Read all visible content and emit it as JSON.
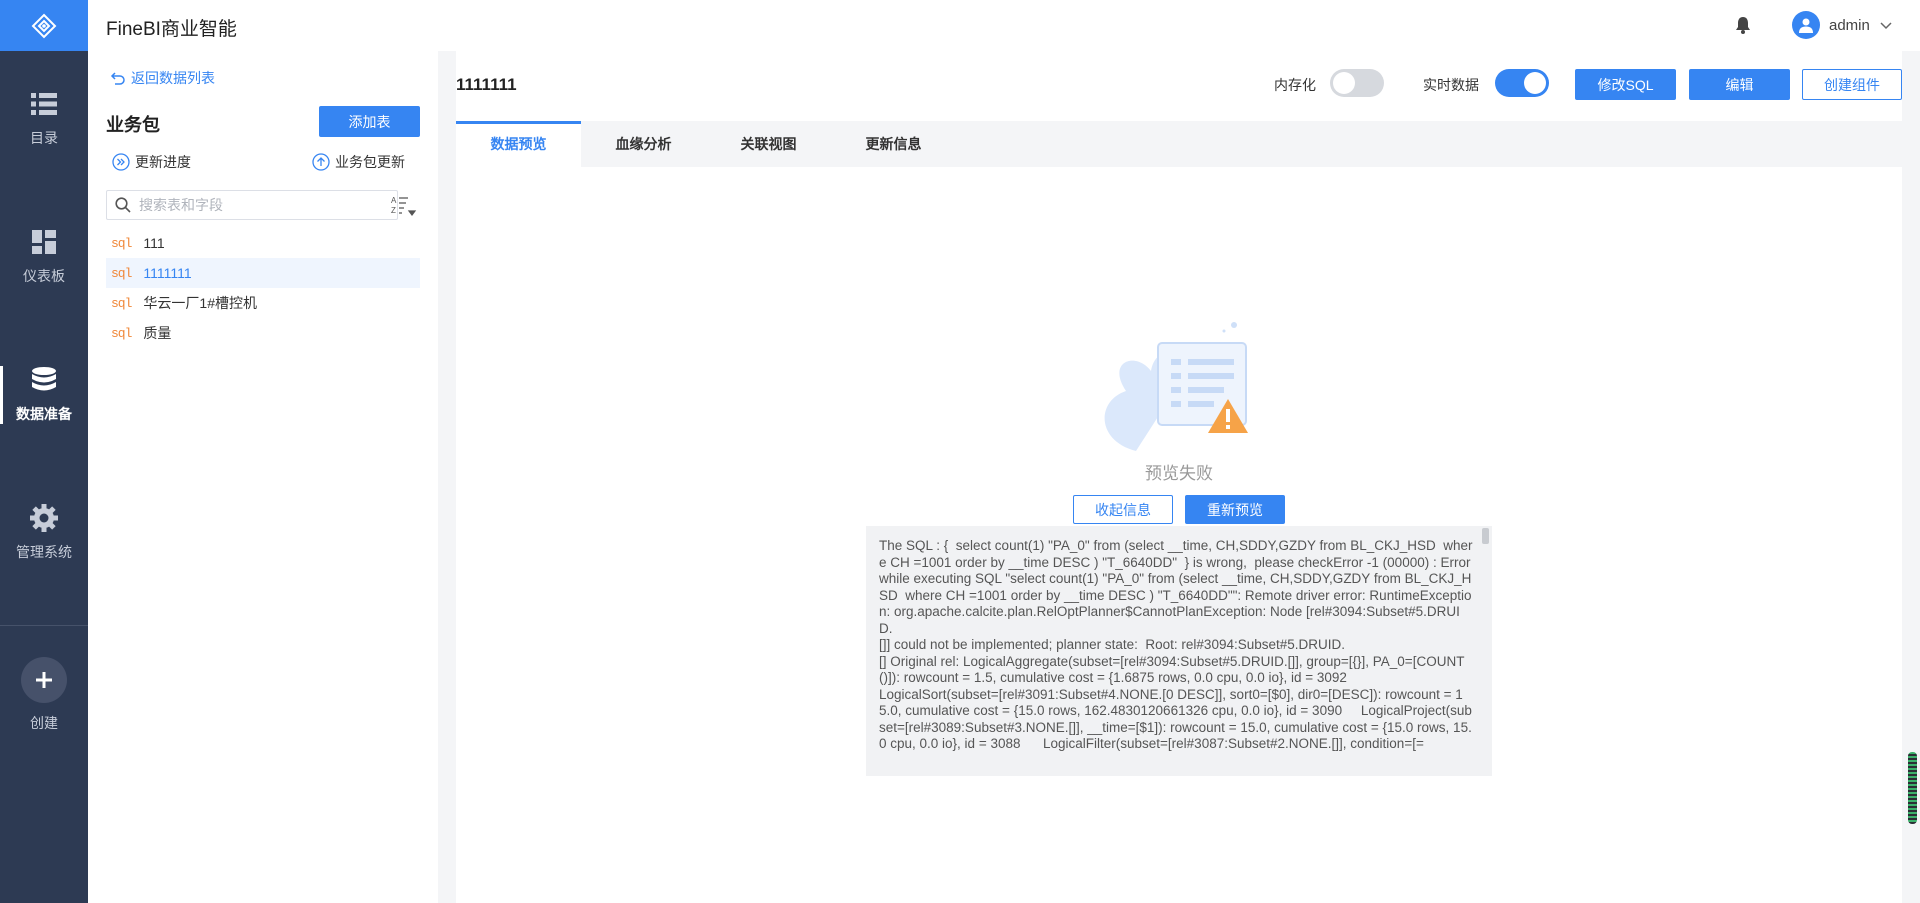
{
  "header": {
    "app_title": "FineBI商业智能",
    "user": "admin"
  },
  "nav": {
    "items": [
      {
        "label": "目录",
        "icon": "list-icon"
      },
      {
        "label": "仪表板",
        "icon": "dashboard-icon"
      },
      {
        "label": "数据准备",
        "icon": "database-icon",
        "active": true
      },
      {
        "label": "管理系统",
        "icon": "gear-icon"
      },
      {
        "label": "创建",
        "icon": "plus-icon"
      }
    ]
  },
  "side": {
    "back_label": "返回数据列表",
    "title": "业务包",
    "add_table_label": "添加表",
    "update_progress_label": "更新进度",
    "package_update_label": "业务包更新",
    "search_placeholder": "搜索表和字段",
    "tables": [
      {
        "tag": "sql",
        "name": "111"
      },
      {
        "tag": "sql",
        "name": "1111111",
        "selected": true
      },
      {
        "tag": "sql",
        "name": "华云一厂1#槽控机"
      },
      {
        "tag": "sql",
        "name": "质量"
      }
    ]
  },
  "main": {
    "title": "1111111",
    "memory_label": "内存化",
    "memory_on": false,
    "realtime_label": "实时数据",
    "realtime_on": true,
    "edit_sql_label": "修改SQL",
    "edit_label": "编辑",
    "create_component_label": "创建组件",
    "tabs": [
      "数据预览",
      "血缘分析",
      "关联视图",
      "更新信息"
    ],
    "active_tab": "数据预览",
    "fail_text": "预览失败",
    "collapse_label": "收起信息",
    "retry_label": "重新预览",
    "error_message": "The SQL : {  select count(1) \"PA_0\" from (select __time, CH,SDDY,GZDY from BL_CKJ_HSD  where CH =1001 order by __time DESC ) \"T_6640DD\"  } is wrong,  please checkError -1 (00000) : Error while executing SQL \"select count(1) \"PA_0\" from (select __time, CH,SDDY,GZDY from BL_CKJ_HSD  where CH =1001 order by __time DESC ) \"T_6640DD\"\": Remote driver error: RuntimeException: org.apache.calcite.plan.RelOptPlanner$CannotPlanException: Node [rel#3094:Subset#5.DRUID.\n[]] could not be implemented; planner state:  Root: rel#3094:Subset#5.DRUID.\n[] Original rel: LogicalAggregate(subset=[rel#3094:Subset#5.DRUID.[]], group=[{}], PA_0=[COUNT()]): rowcount = 1.5, cumulative cost = {1.6875 rows, 0.0 cpu, 0.0 io}, id = 3092\nLogicalSort(subset=[rel#3091:Subset#4.NONE.[0 DESC]], sort0=[$0], dir0=[DESC]): rowcount = 15.0, cumulative cost = {15.0 rows, 162.4830120661326 cpu, 0.0 io}, id = 3090     LogicalProject(subset=[rel#3089:Subset#3.NONE.[]], __time=[$1]): rowcount = 15.0, cumulative cost = {15.0 rows, 15.0 cpu, 0.0 io}, id = 3088      LogicalFilter(subset=[rel#3087:Subset#2.NONE.[]], condition=[="
  },
  "colors": {
    "accent": "#3685f2",
    "nav_bg": "#2d3a53",
    "sql_tag": "#f0883a"
  }
}
